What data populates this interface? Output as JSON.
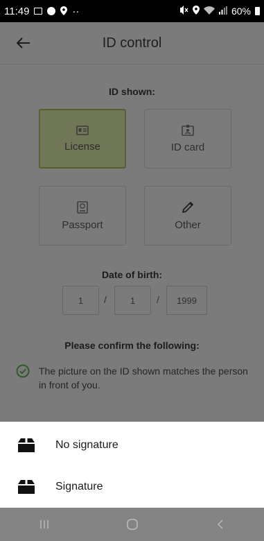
{
  "status_bar": {
    "time": "11:49",
    "battery": "60%",
    "dots": "··"
  },
  "app_bar": {
    "title": "ID control"
  },
  "id_shown": {
    "title": "ID shown:",
    "options": [
      {
        "label": "License",
        "icon": "license-icon",
        "selected": true
      },
      {
        "label": "ID card",
        "icon": "id-card-icon",
        "selected": false
      },
      {
        "label": "Passport",
        "icon": "passport-icon",
        "selected": false
      },
      {
        "label": "Other",
        "icon": "pencil-icon",
        "selected": false
      }
    ]
  },
  "date_of_birth": {
    "title": "Date of birth:",
    "day": "1",
    "month": "1",
    "year": "1999",
    "separator": "/"
  },
  "confirm": {
    "title": "Please confirm the following:",
    "items": [
      {
        "text": "The picture on the ID shown matches the person in front of you.",
        "checked": true
      }
    ]
  },
  "bottom_sheet": {
    "items": [
      {
        "label": "No signature",
        "icon": "box-icon"
      },
      {
        "label": "Signature",
        "icon": "box-icon"
      }
    ]
  },
  "colors": {
    "selected_fill": "#6f7756",
    "selected_border": "#55622f",
    "check_green": "#2f5a27"
  }
}
